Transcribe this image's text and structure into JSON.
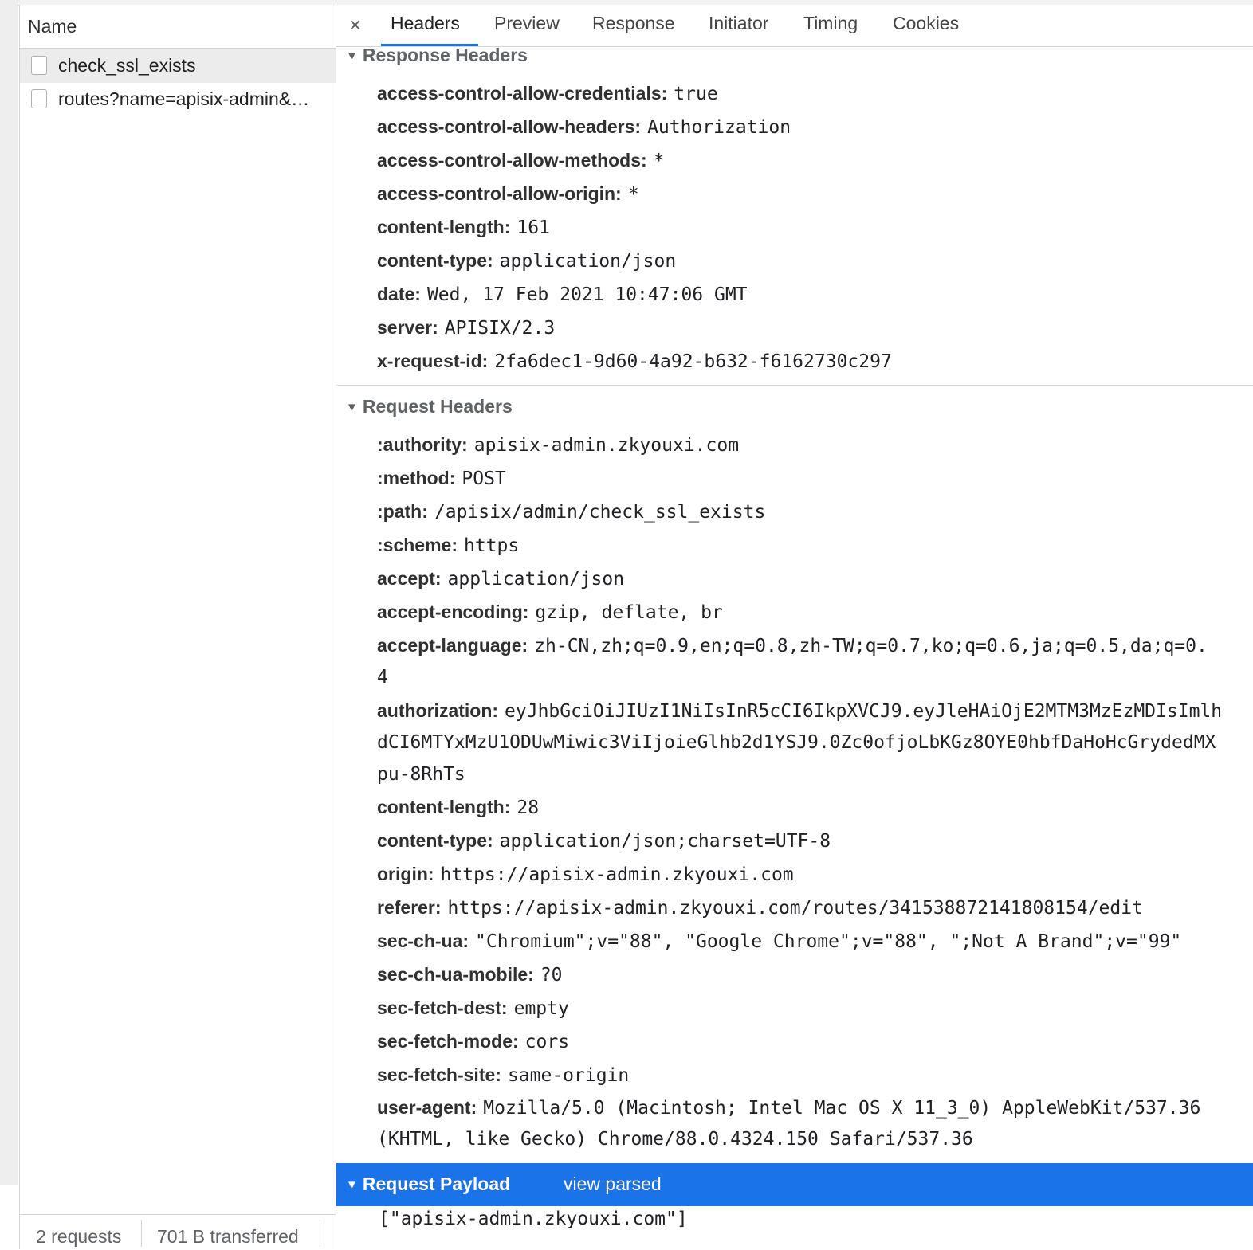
{
  "requests": {
    "column_header": "Name",
    "items": [
      {
        "name": "check_ssl_exists",
        "selected": true
      },
      {
        "name": "routes?name=apisix-admin&…",
        "selected": false
      }
    ],
    "footer": {
      "count": "2 requests",
      "transferred": "701 B transferred"
    }
  },
  "tabs": {
    "close": "×",
    "items": [
      "Headers",
      "Preview",
      "Response",
      "Initiator",
      "Timing",
      "Cookies"
    ],
    "active": "Headers"
  },
  "response_headers": {
    "title": "Response Headers",
    "rows": [
      {
        "key": "access-control-allow-credentials:",
        "value": "true"
      },
      {
        "key": "access-control-allow-headers:",
        "value": "Authorization"
      },
      {
        "key": "access-control-allow-methods:",
        "value": "*"
      },
      {
        "key": "access-control-allow-origin:",
        "value": "*"
      },
      {
        "key": "content-length:",
        "value": "161"
      },
      {
        "key": "content-type:",
        "value": "application/json"
      },
      {
        "key": "date:",
        "value": "Wed, 17 Feb 2021 10:47:06 GMT"
      },
      {
        "key": "server:",
        "value": "APISIX/2.3"
      },
      {
        "key": "x-request-id:",
        "value": "2fa6dec1-9d60-4a92-b632-f6162730c297"
      }
    ]
  },
  "request_headers": {
    "title": "Request Headers",
    "rows": [
      {
        "key": ":authority:",
        "value": "apisix-admin.zkyouxi.com"
      },
      {
        "key": ":method:",
        "value": "POST"
      },
      {
        "key": ":path:",
        "value": "/apisix/admin/check_ssl_exists"
      },
      {
        "key": ":scheme:",
        "value": "https"
      },
      {
        "key": "accept:",
        "value": "application/json"
      },
      {
        "key": "accept-encoding:",
        "value": "gzip, deflate, br"
      },
      {
        "key": "accept-language:",
        "value": "zh-CN,zh;q=0.9,en;q=0.8,zh-TW;q=0.7,ko;q=0.6,ja;q=0.5,da;q=0.",
        "cont": [
          "4"
        ]
      },
      {
        "key": "authorization:",
        "value": "eyJhbGciOiJIUzI1NiIsInR5cCI6IkpXVCJ9.eyJleHAiOjE2MTM3MzEzMDIsImlh",
        "cont": [
          "dCI6MTYxMzU1ODUwMiwic3ViIjoieGlhb2d1YSJ9.0Zc0ofjoLbKGz8OYE0hbfDaHoHcGrydedMX",
          "pu-8RhTs"
        ]
      },
      {
        "key": "content-length:",
        "value": "28"
      },
      {
        "key": "content-type:",
        "value": "application/json;charset=UTF-8"
      },
      {
        "key": "origin:",
        "value": "https://apisix-admin.zkyouxi.com"
      },
      {
        "key": "referer:",
        "value": "https://apisix-admin.zkyouxi.com/routes/341538872141808154/edit"
      },
      {
        "key": "sec-ch-ua:",
        "value": "\"Chromium\";v=\"88\", \"Google Chrome\";v=\"88\", \";Not A Brand\";v=\"99\""
      },
      {
        "key": "sec-ch-ua-mobile:",
        "value": "?0"
      },
      {
        "key": "sec-fetch-dest:",
        "value": "empty"
      },
      {
        "key": "sec-fetch-mode:",
        "value": "cors"
      },
      {
        "key": "sec-fetch-site:",
        "value": "same-origin"
      },
      {
        "key": "user-agent:",
        "value": "Mozilla/5.0 (Macintosh; Intel Mac OS X 11_3_0) AppleWebKit/537.36",
        "cont": [
          "(KHTML, like Gecko) Chrome/88.0.4324.150 Safari/537.36"
        ]
      }
    ]
  },
  "request_payload": {
    "title": "Request Payload",
    "view_parsed": "view parsed",
    "body": "[\"apisix-admin.zkyouxi.com\"]"
  },
  "colors": {
    "accent": "#1a73e8",
    "selected_row": "#ececec",
    "payload_bar": "#1a73e8"
  },
  "icons": {
    "close": "close-icon",
    "expand": "triangle-down-icon",
    "checkbox": "checkbox-icon"
  }
}
